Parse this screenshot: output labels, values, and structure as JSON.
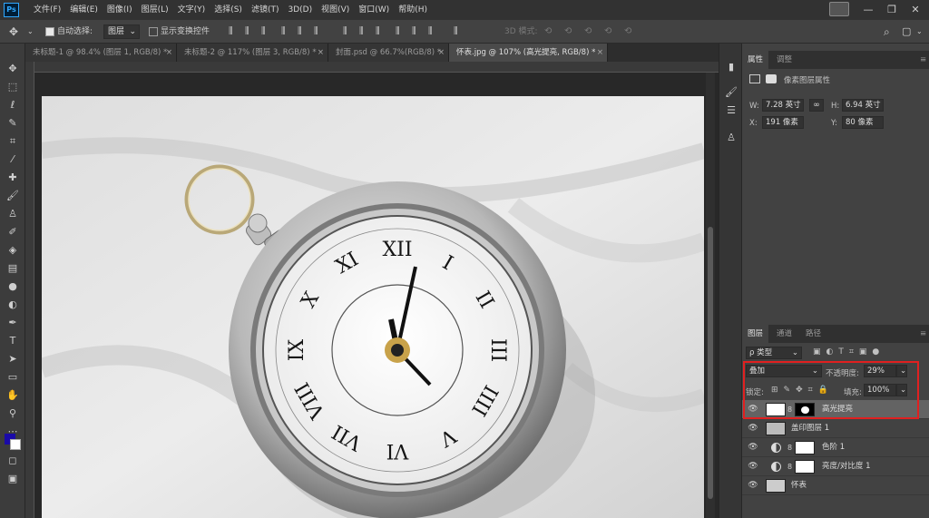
{
  "app": {
    "logo": "Ps"
  },
  "menu": [
    "文件(F)",
    "编辑(E)",
    "图像(I)",
    "图层(L)",
    "文字(Y)",
    "选择(S)",
    "滤镜(T)",
    "3D(D)",
    "视图(V)",
    "窗口(W)",
    "帮助(H)"
  ],
  "options": {
    "auto_select_label": "自动选择:",
    "auto_select_value": "图层",
    "show_transform_label": "显示变换控件",
    "mode_3d_label": "3D 模式:"
  },
  "tabs": [
    {
      "label": "未标题-1 @ 98.4% (图层 1, RGB/8) *"
    },
    {
      "label": "未标题-2 @ 117% (图层 3, RGB/8) *"
    },
    {
      "label": "封面.psd @ 66.7%(RGB/8) *"
    },
    {
      "label": "怀表.jpg @ 107% (高光提亮, RGB/8) *"
    }
  ],
  "colors": {
    "foreground": "#1a0aa8",
    "background": "#ffffff",
    "highlight": "#e02020"
  },
  "properties": {
    "tabs": [
      "属性",
      "调整"
    ],
    "title": "像素图层属性",
    "w_label": "W:",
    "w_value": "7.28 英寸",
    "h_label": "H:",
    "h_value": "6.94 英寸",
    "x_label": "X:",
    "x_value": "191 像素",
    "y_label": "Y:",
    "y_value": "80 像素"
  },
  "layers_panel": {
    "tabs": [
      "图层",
      "通道",
      "路径"
    ],
    "filter_label": "ρ 类型",
    "blend_mode": "叠加",
    "opacity_label": "不透明度:",
    "opacity_value": "29%",
    "lock_label": "锁定:",
    "fill_label": "填充:",
    "fill_value": "100%",
    "layers": [
      {
        "name": "高光提亮",
        "selected": true
      },
      {
        "name": "盖印图层 1"
      },
      {
        "name": "色阶 1"
      },
      {
        "name": "亮度/对比度 1"
      },
      {
        "name": "怀表"
      }
    ]
  },
  "numerals": [
    "XII",
    "I",
    "II",
    "III",
    "IIII",
    "V",
    "VI",
    "VII",
    "VIII",
    "IX",
    "X",
    "XI"
  ]
}
